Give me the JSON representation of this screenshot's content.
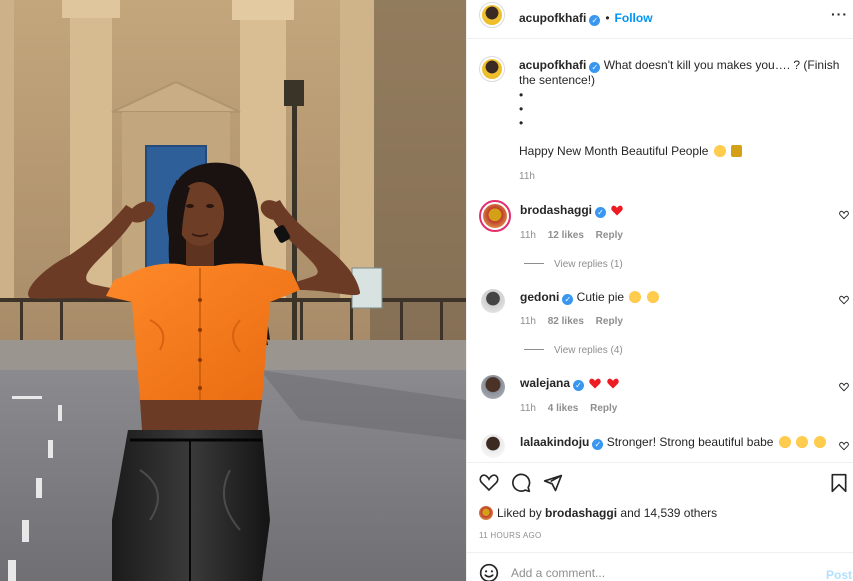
{
  "post": {
    "author": "acupofkhafi",
    "follow_label": "Follow",
    "separator": "•",
    "more_icon": "···"
  },
  "caption": {
    "author": "acupofkhafi",
    "text": "What doesn't kill you makes you…. ? (Finish the sentence!)",
    "bullets": [
      "•",
      "•",
      "•"
    ],
    "text2": "Happy New Month Beautiful People",
    "time": "11h"
  },
  "comments": [
    {
      "user": "brodashaggi",
      "text": "",
      "time": "11h",
      "likes": "12 likes",
      "reply": "Reply",
      "view_replies": "View replies (1)"
    },
    {
      "user": "gedoni",
      "text": "Cutie pie",
      "time": "11h",
      "likes": "82 likes",
      "reply": "Reply",
      "view_replies": "View replies (4)"
    },
    {
      "user": "walejana",
      "text": "",
      "time": "11h",
      "likes": "4 likes",
      "reply": "Reply"
    },
    {
      "user": "lalaakindoju",
      "text": "Stronger! Strong beautiful babe"
    }
  ],
  "likes": {
    "prefix": "Liked by",
    "user": "brodashaggi",
    "rest": "and 14,539 others"
  },
  "posted_ago": "11 HOURS AGO",
  "comment_input": {
    "placeholder": "Add a comment...",
    "post_label": "Post"
  },
  "icons": {
    "verified": "verified-badge-icon",
    "heart": "heart-icon",
    "comment": "comment-icon",
    "share": "share-icon",
    "save": "bookmark-icon",
    "emoji": "emoji-icon"
  },
  "colors": {
    "accent": "#0095f6",
    "verified": "#3897f0",
    "muted": "#8e8e8e",
    "shirt": "#ff7a1a",
    "heart_red": "#ed1c24"
  }
}
